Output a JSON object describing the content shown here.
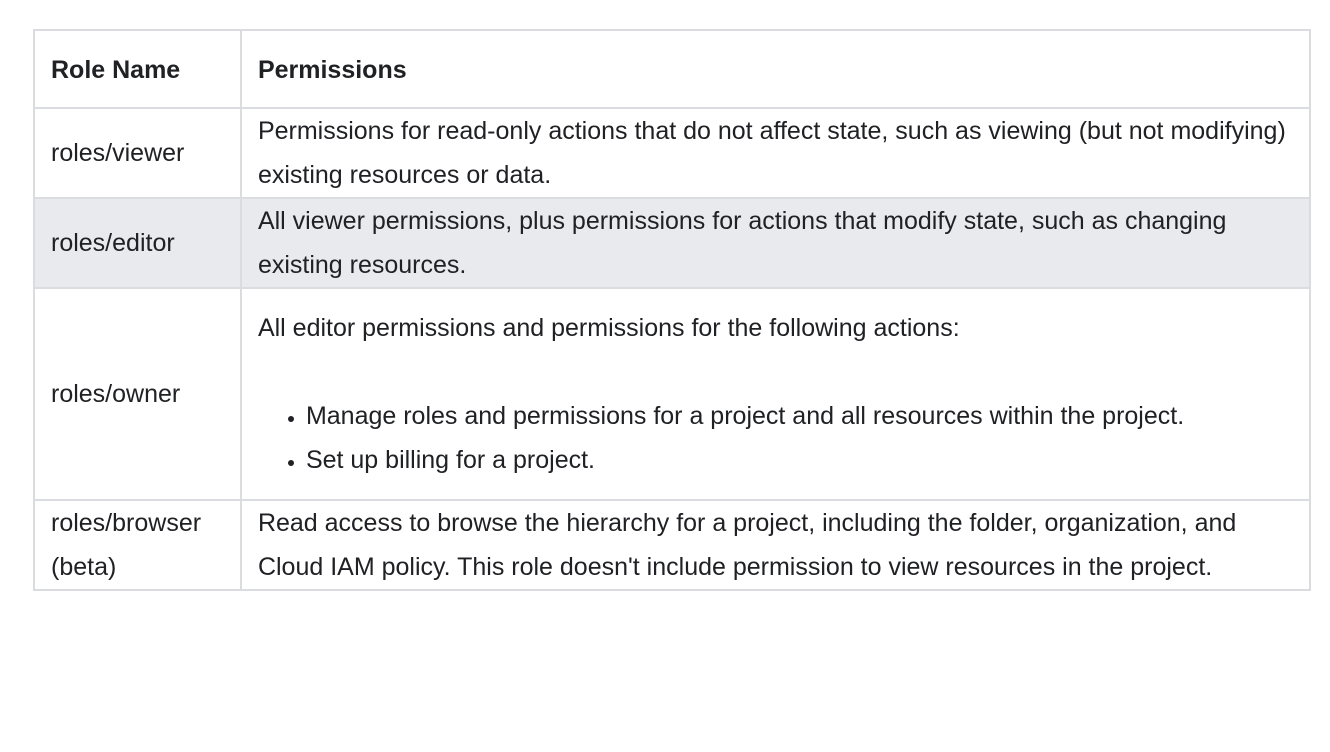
{
  "table": {
    "headers": {
      "role_name": "Role Name",
      "permissions": "Permissions"
    },
    "rows": [
      {
        "role": "roles/viewer",
        "description": "Permissions for read-only actions that do not affect state, such as viewing (but not modifying) existing resources or data."
      },
      {
        "role": "roles/editor",
        "description": "All viewer permissions, plus permissions for actions that modify state, such as changing existing resources."
      },
      {
        "role": "roles/owner",
        "description": "All editor permissions and permissions for the following actions:",
        "bullets": [
          "Manage roles and permissions for a project and all resources within the project.",
          "Set up billing for a project."
        ]
      },
      {
        "role": "roles/browser (beta)",
        "description": "Read access to browse the hierarchy for a project, including the folder, organization, and Cloud IAM policy. This role doesn't include permission to view resources in the project."
      }
    ]
  },
  "colors": {
    "border": "#dadce0",
    "shaded_row": "#e8eaed",
    "text": "#202124"
  }
}
